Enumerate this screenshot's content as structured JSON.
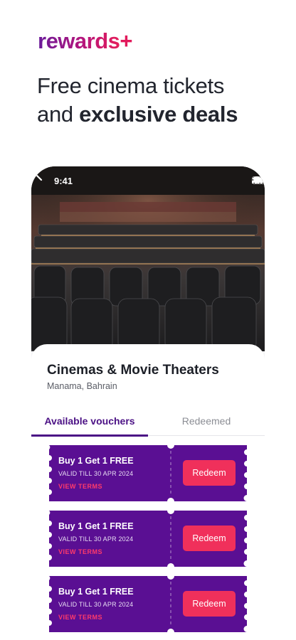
{
  "brand": {
    "logo_text": "rewards",
    "logo_plus": "+"
  },
  "headline": {
    "line1": "Free cinema tickets",
    "line2_prefix": "and ",
    "line2_bold": "exclusive deals"
  },
  "phone": {
    "status": {
      "time": "9:41"
    },
    "venue": {
      "title": "Cinemas & Movie Theaters",
      "location": "Manama, Bahrain"
    },
    "tabs": [
      {
        "label": "Available vouchers"
      },
      {
        "label": "Redeemed"
      }
    ],
    "vouchers": [
      {
        "title": "Buy 1 Get 1 FREE",
        "validity": "VALID TILL 30 APR 2024",
        "terms_label": "VIEW TERMS",
        "button_label": "Redeem"
      },
      {
        "title": "Buy 1 Get 1 FREE",
        "validity": "VALID TILL 30 APR 2024",
        "terms_label": "VIEW TERMS",
        "button_label": "Redeem"
      },
      {
        "title": "Buy 1 Get 1 FREE",
        "validity": "VALID TILL 30 APR 2024",
        "terms_label": "VIEW TERMS",
        "button_label": "Redeem"
      }
    ]
  },
  "colors": {
    "brand_purple": "#4b1185",
    "voucher_purple": "#5a0f93",
    "accent_pink": "#f0305b"
  },
  "icons": [
    "back-chevron-icon",
    "signal-icon",
    "wifi-icon",
    "battery-icon"
  ]
}
